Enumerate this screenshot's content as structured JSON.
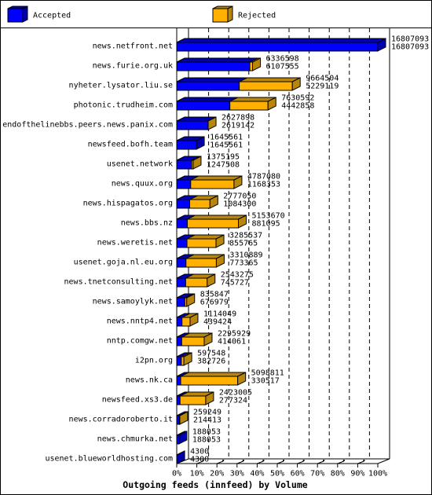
{
  "chart_data": {
    "type": "bar",
    "orientation": "horizontal",
    "stacked": true,
    "three_d": true,
    "title": "Outgoing feeds (innfeed) by Volume",
    "xlabel": "",
    "ylabel": "",
    "xlim": [
      0,
      100
    ],
    "x_unit": "percent of largest total",
    "x_ticks": [
      "0%",
      "10%",
      "20%",
      "30%",
      "40%",
      "50%",
      "60%",
      "70%",
      "80%",
      "90%",
      "100%"
    ],
    "grid": true,
    "legend": {
      "placement": "top",
      "entries": [
        {
          "label": "Accepted",
          "color": "#0000ff",
          "shade": "#0000b0"
        },
        {
          "label": "Rejected",
          "color": "#ffb000",
          "shade": "#b8860b"
        }
      ]
    },
    "categories": [
      "news.netfront.net",
      "news.furie.org.uk",
      "nyheter.lysator.liu.se",
      "photonic.trudheim.com",
      "endofthelinebbs.peers.news.panix.com",
      "newsfeed.bofh.team",
      "usenet.network",
      "news.quux.org",
      "news.hispagatos.org",
      "news.bbs.nz",
      "news.weretis.net",
      "usenet.goja.nl.eu.org",
      "news.tnetconsulting.net",
      "news.samoylyk.net",
      "news.nntp4.net",
      "nntp.comgw.net",
      "i2pn.org",
      "news.nk.ca",
      "newsfeed.xs3.de",
      "news.corradoroberto.it",
      "news.chmurka.net",
      "usenet.blueworldhosting.com"
    ],
    "series": [
      {
        "name": "Accepted",
        "values": [
          16807093,
          6107555,
          5229119,
          4442858,
          2619142,
          1645561,
          1247508,
          1168353,
          1084300,
          881095,
          855765,
          773365,
          745727,
          676979,
          439424,
          414061,
          382726,
          330517,
          277324,
          214413,
          188053,
          4300
        ]
      },
      {
        "name": "Rejected",
        "values": [
          0,
          229043,
          4435385,
          3187734,
          8756,
          0,
          127687,
          3618727,
          1692750,
          4272575,
          2429772,
          2537524,
          1797548,
          158868,
          674625,
          1881868,
          214822,
          4768294,
          2145681,
          44836,
          0,
          0
        ]
      }
    ],
    "value_labels": {
      "total": [
        16807093,
        6336598,
        9664504,
        7630592,
        2627898,
        1645561,
        1375195,
        4787080,
        2777050,
        5153670,
        3285537,
        3310889,
        2543275,
        835847,
        1114049,
        2295929,
        597548,
        5098811,
        2423005,
        259249,
        188053,
        4300
      ],
      "accepted": [
        16807093,
        6107555,
        5229119,
        4442858,
        2619142,
        1645561,
        1247508,
        1168353,
        1084300,
        881095,
        855765,
        773365,
        745727,
        676979,
        439424,
        414061,
        382726,
        330517,
        277324,
        214413,
        188053,
        4300
      ]
    }
  }
}
